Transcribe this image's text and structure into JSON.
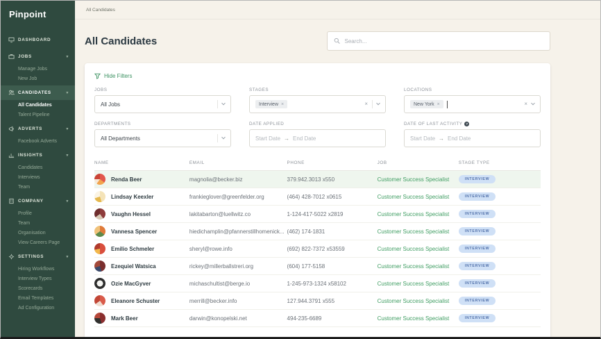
{
  "brand": {
    "logo": "Pinpoint"
  },
  "topbar": {
    "breadcrumb": "All Candidates"
  },
  "sidebar": {
    "sections": [
      {
        "label": "DASHBOARD",
        "items": []
      },
      {
        "label": "JOBS",
        "items": [
          {
            "label": "Manage Jobs"
          },
          {
            "label": "New Job"
          }
        ]
      },
      {
        "label": "CANDIDATES",
        "items": [
          {
            "label": "All Candidates"
          },
          {
            "label": "Talent Pipeline"
          }
        ]
      },
      {
        "label": "ADVERTS",
        "items": [
          {
            "label": "Facebook Adverts"
          }
        ]
      },
      {
        "label": "INSIGHTS",
        "items": [
          {
            "label": "Candidates"
          },
          {
            "label": "Interviews"
          },
          {
            "label": "Team"
          }
        ]
      },
      {
        "label": "COMPANY",
        "items": [
          {
            "label": "Profile"
          },
          {
            "label": "Team"
          },
          {
            "label": "Organisation"
          },
          {
            "label": "View Careers Page"
          }
        ]
      },
      {
        "label": "SETTINGS",
        "items": [
          {
            "label": "Hiring Workflows"
          },
          {
            "label": "Interview Types"
          },
          {
            "label": "Scorecards"
          },
          {
            "label": "Email Templates"
          },
          {
            "label": "Ad Configuration"
          }
        ]
      }
    ]
  },
  "page": {
    "title": "All Candidates"
  },
  "search": {
    "placeholder": "Search..."
  },
  "filters": {
    "toggle_label": "Hide Filters",
    "jobs": {
      "label": "JOBS",
      "value": "All Jobs"
    },
    "stages": {
      "label": "STAGES",
      "tags": [
        "Interview"
      ]
    },
    "locations": {
      "label": "LOCATIONS",
      "tags": [
        "New York"
      ]
    },
    "departments": {
      "label": "DEPARTMENTS",
      "value": "All Departments"
    },
    "date_applied": {
      "label": "DATE APPLIED",
      "start": "Start Date",
      "end": "End Date"
    },
    "last_activity": {
      "label": "DATE OF LAST ACTIVITY",
      "start": "Start Date",
      "end": "End Date"
    }
  },
  "icons": {
    "caret": "▾",
    "close": "×",
    "arrow": "→",
    "info": "?"
  },
  "table": {
    "columns": [
      "NAME",
      "EMAIL",
      "PHONE",
      "JOB",
      "STAGE TYPE"
    ],
    "rows": [
      {
        "name": "Renda Beer",
        "email": "magnolia@becker.biz",
        "phone": "379.942.3013 x550",
        "job": "Customer Success Specialist",
        "stage": "Interview"
      },
      {
        "name": "Lindsay Keexler",
        "email": "frankieglover@greenfelder.org",
        "phone": "(464) 428-7012 x0615",
        "job": "Customer Success Specialist",
        "stage": "Interview"
      },
      {
        "name": "Vaughn Hessel",
        "email": "lakitabarton@luellwitz.co",
        "phone": "1-124-417-5022 x2819",
        "job": "Customer Success Specialist",
        "stage": "Interview"
      },
      {
        "name": "Vannesa Spencer",
        "email": "hiedichamplin@pfannerstillhomenick...",
        "phone": "(462) 174-1831",
        "job": "Customer Success Specialist",
        "stage": "Interview"
      },
      {
        "name": "Emilio Schmeler",
        "email": "sheryl@rowe.info",
        "phone": "(692) 822-7372 x53559",
        "job": "Customer Success Specialist",
        "stage": "Interview"
      },
      {
        "name": "Ezequiel Watsica",
        "email": "rickey@millerballstreri.org",
        "phone": "(604) 177-5158",
        "job": "Customer Success Specialist",
        "stage": "Interview"
      },
      {
        "name": "Ozie MacGyver",
        "email": "michaschultist@berge.io",
        "phone": "1-245-973-1324 x58102",
        "job": "Customer Success Specialist",
        "stage": "Interview"
      },
      {
        "name": "Eleanore Schuster",
        "email": "merrill@becker.info",
        "phone": "127.944.3791 x555",
        "job": "Customer Success Specialist",
        "stage": "Interview"
      },
      {
        "name": "Mark Beer",
        "email": "darwin@konopelski.net",
        "phone": "494-235-6689",
        "job": "Customer Success Specialist",
        "stage": "Interview"
      }
    ]
  },
  "colors": {
    "sidebar_green": "#2f4a3f",
    "accent_green": "#3a9160",
    "badge_bg": "#cfe0f6",
    "badge_text": "#5372ab",
    "page_cream": "#f6f2ea"
  }
}
